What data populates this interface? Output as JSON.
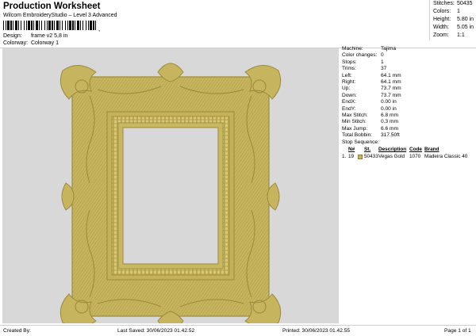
{
  "header": {
    "title": "Production Worksheet",
    "subtitle": "Wilcom EmbroideryStudio – Level 3 Advanced",
    "barcode_suffix": ",",
    "design_label": "Design:",
    "design_value": "frame v2 5,8 in",
    "colorway_label": "Colorway:",
    "colorway_value": "Colorway 1"
  },
  "stats": [
    {
      "label": "Stitches:",
      "value": "50435"
    },
    {
      "label": "Colors:",
      "value": "1"
    },
    {
      "label": "Height:",
      "value": "5.80 in"
    },
    {
      "label": "Width:",
      "value": "5.05 in"
    },
    {
      "label": "Zoom:",
      "value": "1:1"
    }
  ],
  "machine": [
    {
      "label": "Machine:",
      "value": "Tajima"
    },
    {
      "label": "Color changes:",
      "value": "0"
    },
    {
      "label": "Stops:",
      "value": "1"
    },
    {
      "label": "Trims:",
      "value": "37"
    },
    {
      "label": "Left:",
      "value": "64.1 mm"
    },
    {
      "label": "Right:",
      "value": "64.1 mm"
    },
    {
      "label": "Up:",
      "value": "73.7 mm"
    },
    {
      "label": "Down:",
      "value": "73.7 mm"
    },
    {
      "label": "EndX:",
      "value": "0.00 in"
    },
    {
      "label": "EndY:",
      "value": "0.00 in"
    },
    {
      "label": "Max Stitch:",
      "value": "6.8 mm"
    },
    {
      "label": "Min Stitch:",
      "value": "0.3 mm"
    },
    {
      "label": "Max Jump:",
      "value": "6.6 mm"
    },
    {
      "label": "Total Bobbin:",
      "value": "317.50ft"
    }
  ],
  "stop_sequence": {
    "title": "Stop Sequence:",
    "columns": [
      "N#",
      "St.",
      "Description",
      "Code",
      "Brand"
    ],
    "rows": [
      {
        "index": "1.",
        "n": "19",
        "stitches": "50433",
        "description": "Vegas Gold",
        "code": "1070",
        "brand": "Madeira Classic 40",
        "color": "#c6b45f"
      }
    ]
  },
  "preview": {
    "background": "#d8d8d8",
    "thread_color": "#c6b45f"
  },
  "footer": {
    "created": "Created By:",
    "saved": "Last Saved: 30/06/2023 01.42.52",
    "printed": "Printed: 30/06/2023 01.42.55",
    "page": "Page 1 of 1"
  }
}
